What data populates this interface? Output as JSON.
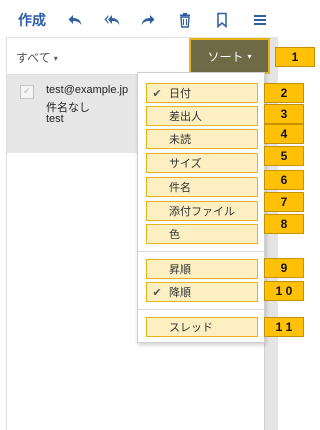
{
  "toolbar": {
    "compose_label": "作成",
    "icons": [
      "reply-icon",
      "reply-all-icon",
      "forward-icon",
      "delete-icon",
      "bookmark-icon",
      "menu-icon"
    ]
  },
  "filter": {
    "label": "すべて",
    "caret": "▾"
  },
  "sort_button": {
    "label": "ソート",
    "caret": "▾"
  },
  "mail": {
    "from": "test@example.jp",
    "subject": "件名なし",
    "body": "test",
    "checked_glyph": "✓"
  },
  "sort_menu": {
    "fields": [
      {
        "label": "日付",
        "checked": true
      },
      {
        "label": "差出人",
        "checked": false
      },
      {
        "label": "未読",
        "checked": false
      },
      {
        "label": "サイズ",
        "checked": false
      },
      {
        "label": "件名",
        "checked": false
      },
      {
        "label": "添付ファイル",
        "checked": false
      },
      {
        "label": "色",
        "checked": false
      }
    ],
    "order": [
      {
        "label": "昇順",
        "checked": false
      },
      {
        "label": "降順",
        "checked": true
      }
    ],
    "thread": {
      "label": "スレッド",
      "checked": false
    },
    "check_glyph": "✔"
  },
  "badges": [
    "1",
    "2",
    "3",
    "4",
    "5",
    "6",
    "7",
    "8",
    "9",
    "1 0",
    "1 1"
  ],
  "colors": {
    "accent": "#2a5ea8",
    "sort_button_bg": "#6e6a46",
    "highlight_border": "#e6b31b",
    "highlight_fill": "#fcf0c2",
    "badge": "#ffc107"
  }
}
